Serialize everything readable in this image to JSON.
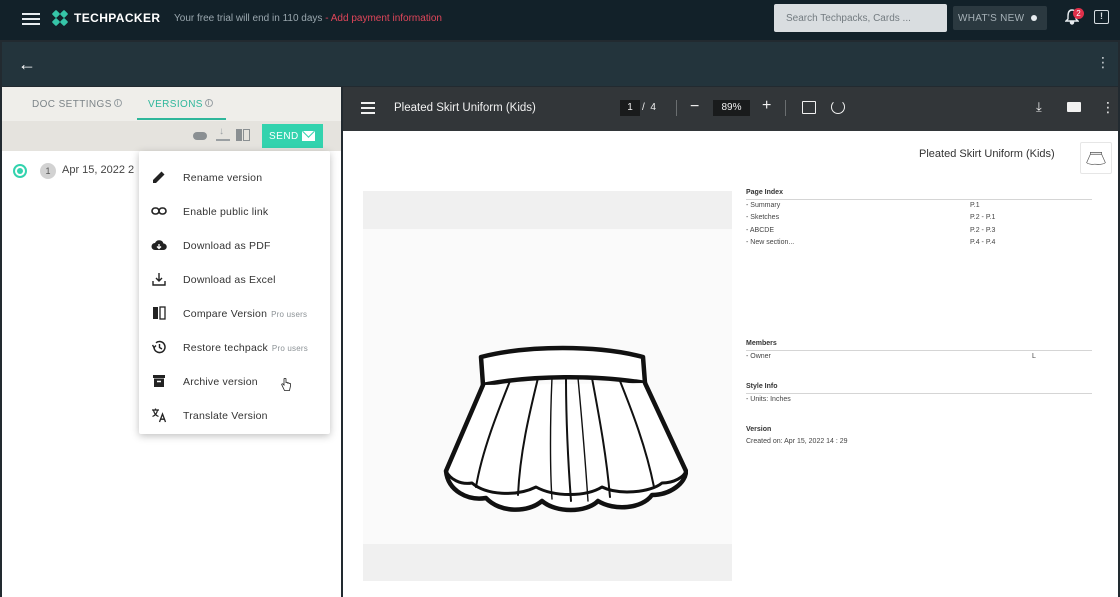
{
  "topbar": {
    "brand": "TECHPACKER",
    "trial_text": "Your free trial will end in 110 days",
    "trial_sep": " - ",
    "payment_link": "Add payment information",
    "search_placeholder": "Search Techpacks, Cards ...",
    "whats_new": "WHAT'S NEW",
    "notification_count": "2",
    "feedback_glyph": "!"
  },
  "left_panel": {
    "tabs": [
      {
        "label": "DOC SETTINGS",
        "active": false
      },
      {
        "label": "VERSIONS",
        "active": true
      }
    ],
    "tab_info_glyph": "i",
    "send_label": "SEND",
    "versions": [
      {
        "number": "1",
        "date": "Apr 15, 2022 2"
      }
    ]
  },
  "menu": {
    "items": [
      {
        "label": "Rename version",
        "icon": "pencil-icon",
        "pro": ""
      },
      {
        "label": "Enable public link",
        "icon": "link-icon",
        "pro": ""
      },
      {
        "label": "Download as PDF",
        "icon": "cloud-download-icon",
        "pro": ""
      },
      {
        "label": "Download as Excel",
        "icon": "download-icon",
        "pro": ""
      },
      {
        "label": "Compare Version",
        "icon": "compare-icon",
        "pro": "Pro users"
      },
      {
        "label": "Restore techpack",
        "icon": "history-icon",
        "pro": "Pro users"
      },
      {
        "label": "Archive version",
        "icon": "archive-icon",
        "pro": ""
      },
      {
        "label": "Translate Version",
        "icon": "translate-icon",
        "pro": ""
      }
    ]
  },
  "viewer": {
    "title": "Pleated Skirt Uniform (Kids)",
    "current_page": "1",
    "page_sep": "/",
    "total_pages": "4",
    "zoom": "89%"
  },
  "document": {
    "title": "Pleated Skirt Uniform (Kids)",
    "page_index": {
      "heading": "Page Index",
      "rows": [
        {
          "name": "- Summary",
          "page": "P.1"
        },
        {
          "name": "- Sketches",
          "page": "P.2 - P.1"
        },
        {
          "name": "- ABCDE",
          "page": "P.2 - P.3"
        },
        {
          "name": "- New section...",
          "page": "P.4 - P.4"
        }
      ]
    },
    "members": {
      "heading": "Members",
      "rows": [
        {
          "name": "- Owner",
          "value": "L"
        }
      ]
    },
    "style_info": {
      "heading": "Style Info",
      "rows": [
        {
          "name": "- Units: Inches"
        }
      ]
    },
    "version": {
      "heading": "Version",
      "created": "Created on: Apr 15, 2022 14 : 29"
    }
  },
  "colors": {
    "accent": "#33d3ae",
    "topbar": "#122129",
    "viewer_bar": "#323639",
    "alert": "#e0465a"
  }
}
